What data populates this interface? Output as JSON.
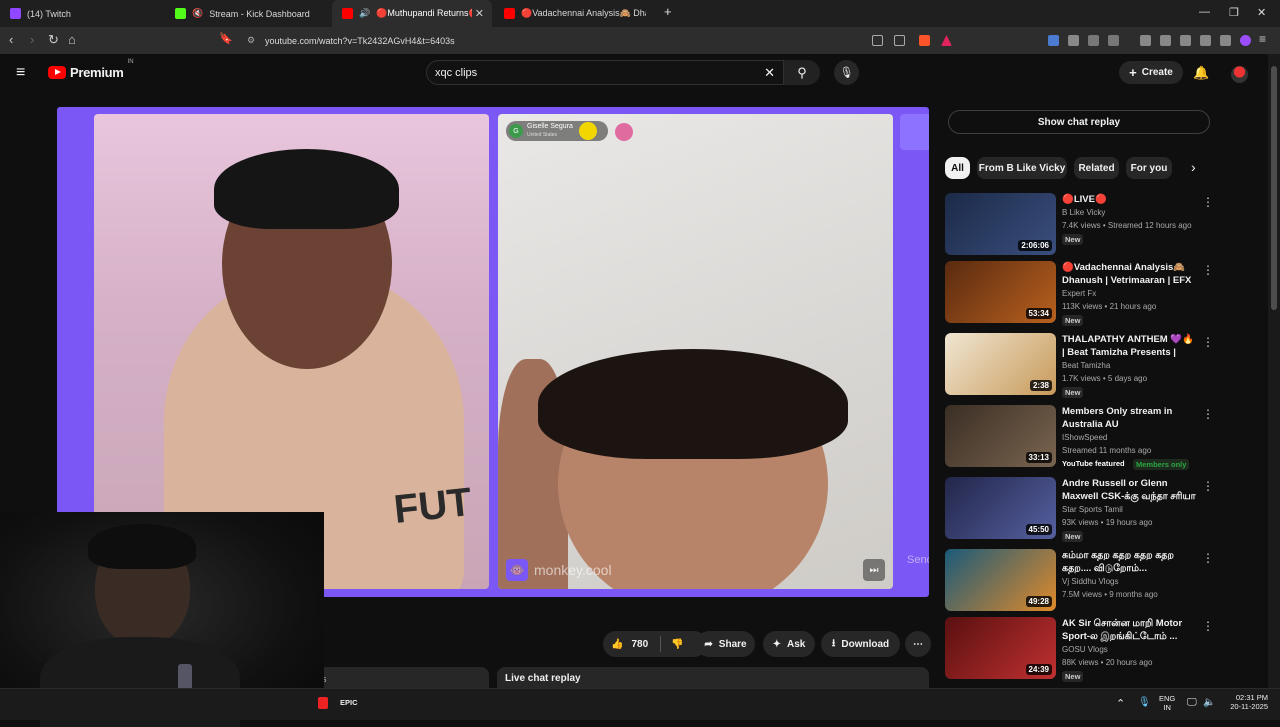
{
  "browser": {
    "tabs": [
      {
        "label": "(14) Twitch",
        "color": "#9146ff"
      },
      {
        "label": "Stream - Kick Dashboard",
        "color": "#53fc18"
      },
      {
        "label": "🔴Muthupandi Returns🔴 - Y",
        "color": "#ff0000"
      },
      {
        "label": "🔴Vadachennai Analysis🙈 Dhanush",
        "color": "#ff0000"
      }
    ],
    "url": "youtube.com/watch?v=Tk2432AGvH4&t=6403s"
  },
  "youtube": {
    "logo_text": "Premium",
    "logo_region": "IN",
    "search_value": "xqc clips",
    "create_label": "Create"
  },
  "player": {
    "participant_name": "Giselle Segura",
    "participant_country": "United States",
    "participant_initial": "G",
    "watermark": "monkey.cool",
    "send_label": "Send"
  },
  "actions": {
    "like_count": "780",
    "share_label": "Share",
    "ask_label": "Ask",
    "download_label": "Download"
  },
  "below": {
    "left_tab_fragment": "s",
    "live_chat_label": "Live chat replay"
  },
  "sidebar": {
    "show_chat_replay": "Show chat replay",
    "chips": [
      "All",
      "From B Like Vicky",
      "Related",
      "For you"
    ],
    "recommendations": [
      {
        "title": "🔴LIVE🔴",
        "channel": "B Like Vicky",
        "meta": "7.4K views • Streamed 12 hours ago",
        "duration": "2:06:06",
        "badge": "New",
        "thumb_color": "#2a3550"
      },
      {
        "title": "🔴Vadachennai Analysis🙈 Dhanush | Vetrimaaran | EFX ...",
        "channel": "Expert Fx",
        "meta": "113K views • 21 hours ago",
        "duration": "53:34",
        "badge": "New",
        "thumb_color": "#7a3b1c"
      },
      {
        "title": "THALAPATHY ANTHEM 💜🔥 | Beat Tamizha Presents | REAL ...",
        "channel": "Beat Tamizha",
        "meta": "1.7K views • 5 days ago",
        "duration": "2:38",
        "badge": "New",
        "thumb_color": "#c8b48a"
      },
      {
        "title": "Members Only stream in Australia AU",
        "channel": "IShowSpeed",
        "meta": "Streamed 11 months ago",
        "duration": "33:13",
        "badge": "YouTube featured",
        "badge2": "Members only",
        "thumb_color": "#5a4a3a"
      },
      {
        "title": "Andre Russell or Glenn Maxwell CSK-க்கு வந்தா சரியா ...",
        "channel": "Star Sports Tamil",
        "meta": "93K views • 19 hours ago",
        "duration": "45:50",
        "badge": "New",
        "thumb_color": "#3b3f6a"
      },
      {
        "title": "சும்மா கதற கதற கதற கதற கதற.... விடுறோம்...",
        "channel": "Vj Siddhu Vlogs",
        "meta": "7.5M views • 9 months ago",
        "duration": "49:28",
        "badge": "",
        "thumb_color": "#2f6b8a"
      },
      {
        "title": "AK Sir சொன்ன மாறி Motor Sport-ல இறங்கிட்டோம் ...",
        "channel": "GOSU Vlogs",
        "meta": "88K views • 20 hours ago",
        "duration": "24:39",
        "badge": "New",
        "thumb_color": "#8a2222"
      }
    ]
  },
  "taskbar": {
    "lang": "ENG",
    "region": "IN",
    "time": "02:31 PM",
    "date": "20-11-2025",
    "app": "EPIC"
  }
}
